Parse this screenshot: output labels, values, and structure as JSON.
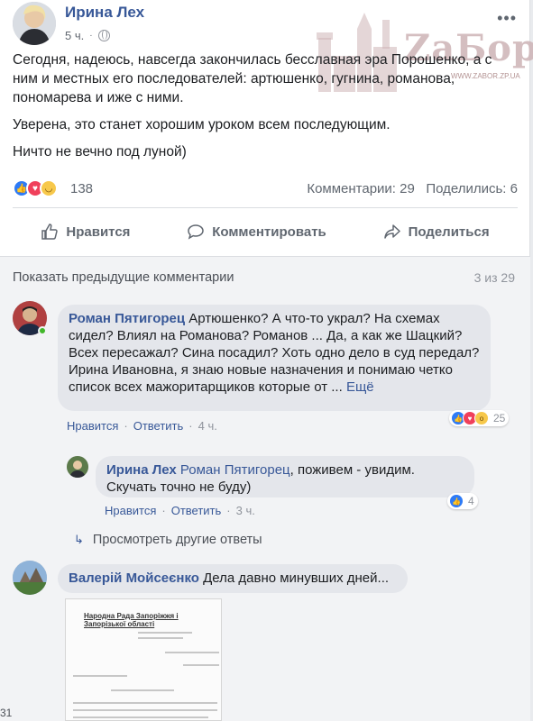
{
  "post": {
    "author": "Ирина Лех",
    "time": "5 ч.",
    "paragraphs": [
      "Сегодня, надеюсь, навсегда закончилась бесславная эра Порошенко, а с ним и местных его последователей: артюшенко, гугнина, романова, пономарева и иже с ними.",
      "Уверена, это станет хорошим уроком всем последующим.",
      "Ничто не вечно под луной)"
    ],
    "reactions_count": "138",
    "comments_label": "Комментарии: 29",
    "shares_label": "Поделились: 6"
  },
  "watermark": {
    "text": "ZaБор",
    "sub": "WWW.ZABOR.ZP.UA"
  },
  "actions": {
    "like": "Нравится",
    "comment": "Комментировать",
    "share": "Поделиться"
  },
  "comments_header": {
    "prev_link": "Показать предыдущие комментарии",
    "count": "3 из 29"
  },
  "comment1": {
    "author": "Роман Пятигорец",
    "text": " Артюшенко? А что-то украл? На схемах сидел? Влиял на Романова? Романов ... Да, а как же Шацкий? Всех пересажал? Сина посадил? Хоть одно дело в суд передал? Ирина Ивановна, я знаю новые назначения и понимаю четко список всех мажоритарщиков которые от ... ",
    "more": "Ещё",
    "like": "Нравится",
    "reply": "Ответить",
    "time": "4 ч.",
    "reactions": "25"
  },
  "reply1": {
    "author": "Ирина Лех",
    "tag": "Роман Пятигорец",
    "text": ", поживем - увидим. Скучать точно не буду)",
    "like": "Нравится",
    "reply": "Ответить",
    "time": "3 ч.",
    "reactions": "4"
  },
  "more_replies": "Просмотреть другие ответы",
  "comment2": {
    "author": "Валерій Мойсеєнко",
    "text": " Дела давно минувших дней..."
  },
  "doc": {
    "title": "Народна Рада Запоріжжя і Запорізької області"
  },
  "edge_number": "31",
  "colors": {
    "link": "#385898",
    "like_blue": "#2e7bf6",
    "love_red": "#f0405b",
    "haha_yellow": "#f7c84b",
    "bubble": "#e4e6eb"
  }
}
